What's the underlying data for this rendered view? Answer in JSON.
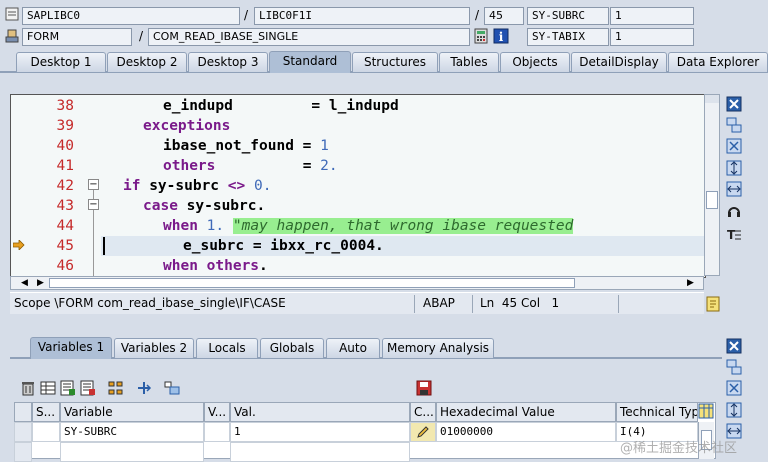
{
  "header": {
    "program": "SAPLIBC0",
    "include": "LIBC0F1I",
    "line": "45",
    "field1_label": "SY-SUBRC",
    "field1_value": "1",
    "event_type": "FORM",
    "event_name": "COM_READ_IBASE_SINGLE",
    "field2_label": "SY-TABIX",
    "field2_value": "1",
    "sep": "/"
  },
  "tabs": [
    {
      "label": "Desktop 1"
    },
    {
      "label": "Desktop 2"
    },
    {
      "label": "Desktop 3"
    },
    {
      "label": "Standard"
    },
    {
      "label": "Structures"
    },
    {
      "label": "Tables"
    },
    {
      "label": "Objects"
    },
    {
      "label": "DetailDisplay"
    },
    {
      "label": "Data Explorer"
    }
  ],
  "code_lines": [
    {
      "no": "38",
      "parts": [
        {
          "t": "e_indupd         = l_indupd",
          "c": "txt"
        }
      ]
    },
    {
      "no": "39",
      "parts": [
        {
          "t": "exceptions",
          "c": "kw"
        }
      ]
    },
    {
      "no": "40",
      "parts": [
        {
          "t": "ibase_not_found = ",
          "c": "txt"
        },
        {
          "t": "1",
          "c": "num"
        }
      ]
    },
    {
      "no": "41",
      "parts": [
        {
          "t": "others",
          "c": "kw"
        },
        {
          "t": "          = ",
          "c": "txt"
        },
        {
          "t": "2.",
          "c": "num"
        }
      ]
    },
    {
      "no": "42",
      "parts": [
        {
          "t": "if",
          "c": "kw"
        },
        {
          "t": " sy-subrc ",
          "c": "txt"
        },
        {
          "t": "<>",
          "c": "kw"
        },
        {
          "t": " ",
          "c": "txt"
        },
        {
          "t": "0.",
          "c": "num"
        }
      ]
    },
    {
      "no": "43",
      "parts": [
        {
          "t": "case",
          "c": "kw"
        },
        {
          "t": " sy-subrc.",
          "c": "txt"
        }
      ]
    },
    {
      "no": "44",
      "parts": [
        {
          "t": "when",
          "c": "kw"
        },
        {
          "t": " ",
          "c": "txt"
        },
        {
          "t": "1.",
          "c": "num"
        },
        {
          "t": " ",
          "c": "txt"
        },
        {
          "t": "\"may happen, that wrong ibase requested",
          "c": "cmt"
        }
      ]
    },
    {
      "no": "45",
      "parts": [
        {
          "t": "e_subrc = ibxx_rc_0004.",
          "c": "txt"
        }
      ]
    },
    {
      "no": "46",
      "parts": [
        {
          "t": "when",
          "c": "kw"
        },
        {
          "t": " ",
          "c": "txt"
        },
        {
          "t": "others",
          "c": "kw"
        },
        {
          "t": ".",
          "c": "txt"
        }
      ]
    }
  ],
  "status": {
    "scope": "Scope \\FORM com_read_ibase_single\\IF\\CASE",
    "lang": "ABAP",
    "ln": "Ln  45 Col   1",
    "extra": "1"
  },
  "bottom_tabs": [
    {
      "label": "Variables 1"
    },
    {
      "label": "Variables 2"
    },
    {
      "label": "Locals"
    },
    {
      "label": "Globals"
    },
    {
      "label": "Auto"
    },
    {
      "label": "Memory Analysis"
    }
  ],
  "grid": {
    "headers": [
      "S...",
      "Variable",
      "V...",
      "Val.",
      "C...",
      "Hexadecimal Value",
      "Technical Typ"
    ],
    "rows": [
      {
        "variable": "SY-SUBRC",
        "value": "1",
        "hex": "01000000",
        "type": "I(4)"
      }
    ]
  },
  "watermark": "@稀土掘金技术社区",
  "colors": {
    "accent": "#aebfd6",
    "comment_bg": "#98ee90",
    "keyword": "#7a1a8a",
    "line_no": "#c52a2a"
  }
}
